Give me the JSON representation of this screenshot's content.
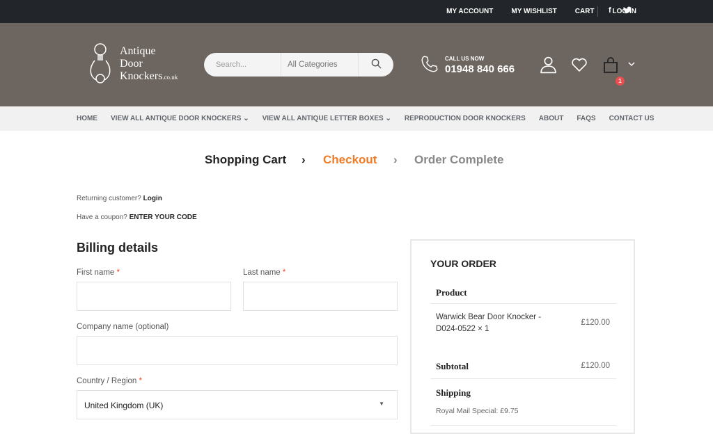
{
  "topbar": {
    "links": [
      "MY ACCOUNT",
      "MY WISHLIST",
      "CART",
      "LOG IN"
    ],
    "social": [
      "facebook-icon",
      "twitter-icon"
    ]
  },
  "header": {
    "logo_line1": "Antique",
    "logo_line2": "Door",
    "logo_line3": "Knockers",
    "logo_suffix": ".co.uk",
    "search_placeholder": "Search...",
    "category": "All Categories",
    "call_label": "CALL US NOW",
    "phone": "01948 840 666",
    "cart_count": "1"
  },
  "nav": [
    "HOME",
    "VIEW ALL ANTIQUE DOOR KNOCKERS",
    "VIEW ALL ANTIQUE LETTER BOXES",
    "REPRODUCTION DOOR KNOCKERS",
    "ABOUT",
    "FAQS",
    "CONTACT US"
  ],
  "steps": {
    "cart": "Shopping Cart",
    "checkout": "Checkout",
    "complete": "Order Complete",
    "active_color": "#f07b26"
  },
  "notices": {
    "returning": "Returning customer?",
    "login": "Login",
    "coupon": "Have a coupon?",
    "coupon_link": "ENTER YOUR CODE"
  },
  "billing": {
    "title": "Billing details",
    "first_name": "First name",
    "last_name": "Last name",
    "company": "Company name (optional)",
    "country": "Country / Region",
    "required": "*",
    "country_value": "United Kingdom (UK)"
  },
  "order": {
    "title": "YOUR ORDER",
    "product_header": "Product",
    "item_line1": "Warwick Bear Door Knocker -",
    "item_line2": "D024-0522  × 1",
    "item_price": "£120.00",
    "subtotal_label": "Subtotal",
    "subtotal": "£120.00",
    "shipping_label": "Shipping",
    "shipping_option": "Royal Mail Special: £9.75"
  }
}
